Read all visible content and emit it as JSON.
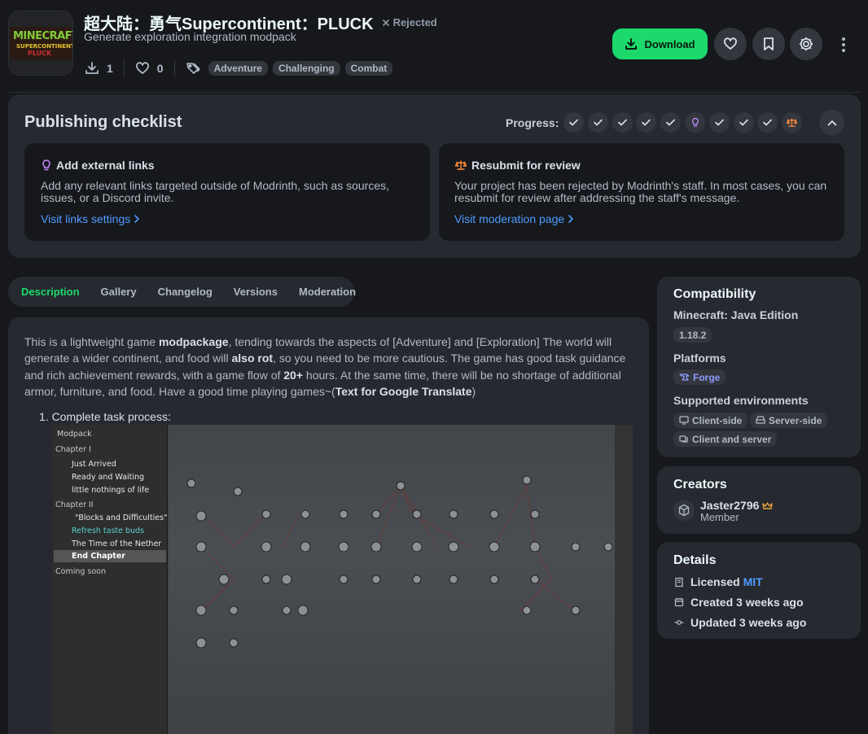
{
  "project": {
    "logo_text": [
      "MINECRAFT",
      "SUPERCONTINENT!",
      "PLUCK"
    ],
    "title": "超大陆：勇气Supercontinent：PLUCK",
    "status": "Rejected",
    "summary": "Generate exploration integration modpack",
    "downloads": "1",
    "follows": "0",
    "tags": [
      "Adventure",
      "Challenging",
      "Combat"
    ],
    "download_label": "Download"
  },
  "checklist": {
    "title": "Publishing checklist",
    "progress_label": "Progress:",
    "progress_steps": [
      "done",
      "done",
      "done",
      "done",
      "done",
      "links",
      "done",
      "done",
      "done",
      "review"
    ],
    "cards": [
      {
        "title": "Add external links",
        "body": "Add any relevant links targeted outside of Modrinth, such as sources, issues, or a Discord invite.",
        "link": "Visit links settings"
      },
      {
        "title": "Resubmit for review",
        "body": "Your project has been rejected by Modrinth's staff. In most cases, you can resubmit for review after addressing the staff's message.",
        "link": "Visit moderation page"
      }
    ]
  },
  "tabs": [
    "Description",
    "Gallery",
    "Changelog",
    "Versions",
    "Moderation"
  ],
  "description": {
    "p1": "This is a lightweight game ",
    "b1": "modpackage",
    "p2": ", tending towards the aspects of [Adventure] and [Exploration] The world will generate a wider continent, and food will ",
    "b2": "also rot",
    "p3": ", so you need to be more cautious. The game has good task guidance and rich achievement rewards, with a game flow of ",
    "b3": "20+",
    "p4": " hours. At the same time, there will be no shortage of additional armor, furniture, and food. Have a good time playing games~(",
    "b4": "Text for Google Translate",
    "p5": ")",
    "list_item": "1. Complete task process:",
    "screenshot": {
      "header": "Modpack",
      "rows": [
        "Chapter I",
        "Just Arrived",
        "Ready and Waiting",
        "little nothings of life",
        "Chapter II",
        "\"Blocks and Difficulties\"",
        "Refresh taste buds",
        "The Time of the Nether",
        "End Chapter",
        "Coming soon"
      ]
    }
  },
  "compatibility": {
    "title": "Compatibility",
    "edition_label": "Minecraft: Java Edition",
    "version": "1.18.2",
    "platforms_label": "Platforms",
    "platform": "Forge",
    "env_label": "Supported environments",
    "envs": [
      "Client-side",
      "Server-side",
      "Client and server"
    ]
  },
  "creators": {
    "title": "Creators",
    "name": "Jaster2796",
    "role": "Member"
  },
  "details": {
    "title": "Details",
    "license_prefix": "Licensed",
    "license": "MIT",
    "created": "Created 3 weeks ago",
    "updated": "Updated 3 weeks ago"
  },
  "colors": {
    "accent": "#1bd96a",
    "link": "#4f9cff",
    "background": "#16181c",
    "panel": "#26292f"
  }
}
